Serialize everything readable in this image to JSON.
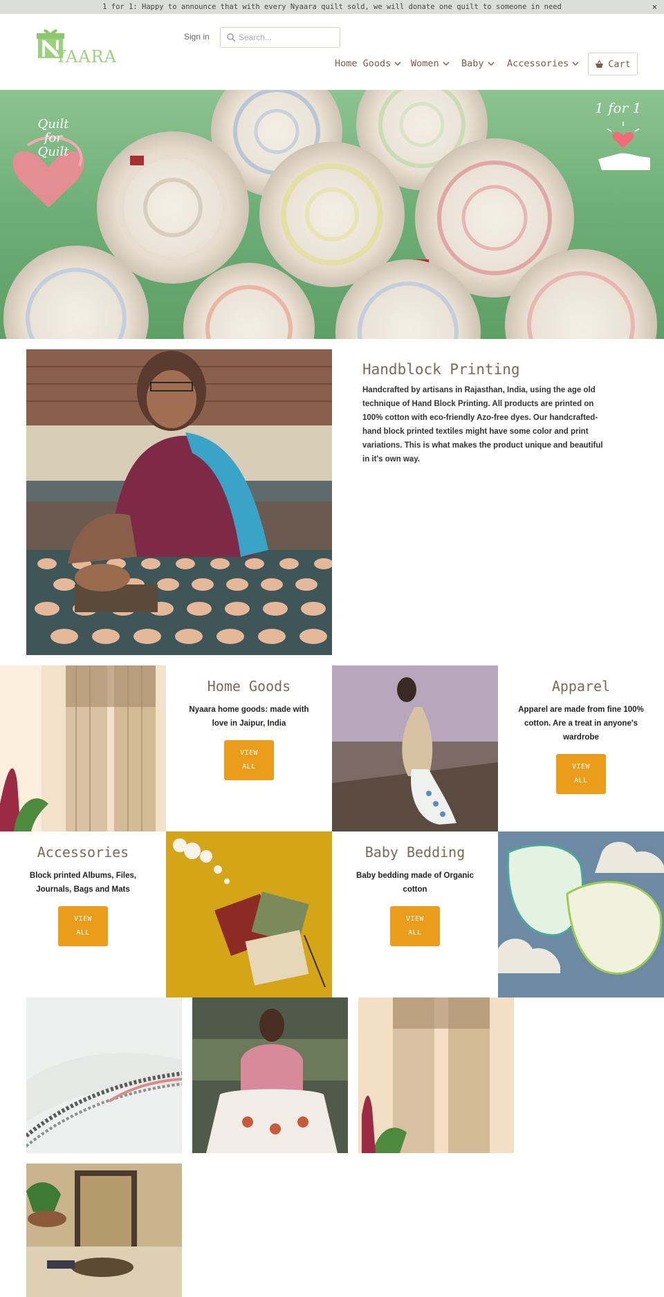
{
  "announcement": {
    "text": "1 for 1: Happy to announce that with every Nyaara quilt sold, we will donate one quilt to someone in need",
    "close": "×"
  },
  "header": {
    "logo_text": "YAARA",
    "signin": "Sign in",
    "search_placeholder": "Search...",
    "nav": [
      "Home Goods",
      "Women",
      "Baby",
      "Accessories"
    ],
    "cart": "Cart"
  },
  "hero": {
    "badge_left": [
      "Quilt",
      "for",
      "Quilt"
    ],
    "badge_right": "1 for 1"
  },
  "handblock": {
    "title": "Handblock Printing",
    "text": "Handcrafted by artisans in Rajasthan, India, using the age old technique of Hand Block Printing. All products are printed on 100% cotton with eco-friendly Azo-free dyes. Our handcrafted-hand block printed textiles might have some color and print variations. This is what makes the product unique and beautiful in it's own way."
  },
  "collections": [
    {
      "title": "Home Goods",
      "text": "Nyaara home goods: made with love in Jaipur, India",
      "button": [
        "VIEW",
        "ALL"
      ]
    },
    {
      "title": "Apparel",
      "text": "Apparel are made from fine 100% cotton. Are a treat in anyone's wardrobe",
      "button": [
        "VIEW",
        "ALL"
      ]
    },
    {
      "title": "Accessories",
      "text": "Block printed Albums, Files, Journals, Bags and Mats",
      "button": [
        "VIEW",
        "ALL"
      ]
    },
    {
      "title": "Baby Bedding",
      "text": "Baby bedding made of Organic cotton",
      "button": [
        "VIEW",
        "ALL"
      ]
    }
  ],
  "colors": {
    "accent": "#ea9c1b",
    "heading": "#7a6a56",
    "nav": "#7a5e45",
    "announce_bg": "#dcdfd9",
    "logo_green": "#9cd17e"
  }
}
